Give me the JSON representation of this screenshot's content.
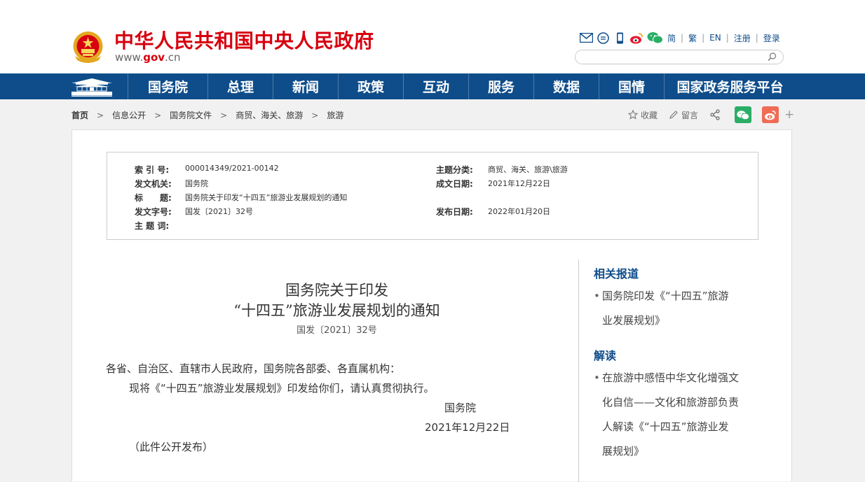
{
  "header": {
    "site_title": "中华人民共和国中央人民政府",
    "site_url_prefix": "www.",
    "site_url_gov": "gov",
    "site_url_suffix": ".cn",
    "tools": {
      "simplified": "简",
      "traditional": "繁",
      "english": "EN",
      "register": "注册",
      "login": "登录"
    },
    "search_placeholder": ""
  },
  "nav": {
    "items": [
      "国务院",
      "总理",
      "新闻",
      "政策",
      "互动",
      "服务",
      "数据",
      "国情",
      "国家政务服务平台"
    ]
  },
  "breadcrumb": {
    "items": [
      "首页",
      "信息公开",
      "国务院文件",
      "商贸、海关、旅游",
      "旅游"
    ],
    "separator": ">"
  },
  "share": {
    "favorite": "收藏",
    "comment": "留言",
    "more": "+"
  },
  "meta": {
    "index_no_label": "索 引 号:",
    "index_no": "000014349/2021-00142",
    "issuer_label": "发文机关:",
    "issuer": "国务院",
    "title_label": "标　　题:",
    "title": "国务院关于印发“十四五”旅游业发展规划的通知",
    "doc_no_label": "发文字号:",
    "doc_no": "国发〔2021〕32号",
    "subject_word_label": "主 题 词:",
    "subject_word": "",
    "category_label": "主题分类:",
    "category": "商贸、海关、旅游\\旅游",
    "written_date_label": "成文日期:",
    "written_date": "2021年12月22日",
    "publish_date_label": "发布日期:",
    "publish_date": "2022年01月20日"
  },
  "document": {
    "title_line1": "国务院关于印发",
    "title_line2": "“十四五”旅游业发展规划的通知",
    "doc_number": "国发〔2021〕32号",
    "salutation": "各省、自治区、直辖市人民政府，国务院各部委、各直属机构：",
    "body": "现将《“十四五”旅游业发展规划》印发给你们，请认真贯彻执行。",
    "signature": "国务院",
    "date": "2021年12月22日",
    "note": "（此件公开发布）"
  },
  "sidebar": {
    "related_heading": "相关报道",
    "related_items": [
      {
        "line1": "国务院印发《“十四五”旅游",
        "line2": "业发展规划》"
      }
    ],
    "interpret_heading": "解读",
    "interpret_items": [
      {
        "line1": "在旅游中感悟中华文化增强文",
        "line2": "化自信——文化和旅游部负责",
        "line3": "人解读《“十四五”旅游业发",
        "line4": "展规划》"
      }
    ]
  },
  "colors": {
    "brand_red": "#d7000f",
    "nav_blue": "#0f4d8a",
    "wechat_green": "#2aae67",
    "weibo_red": "#e6162d"
  }
}
